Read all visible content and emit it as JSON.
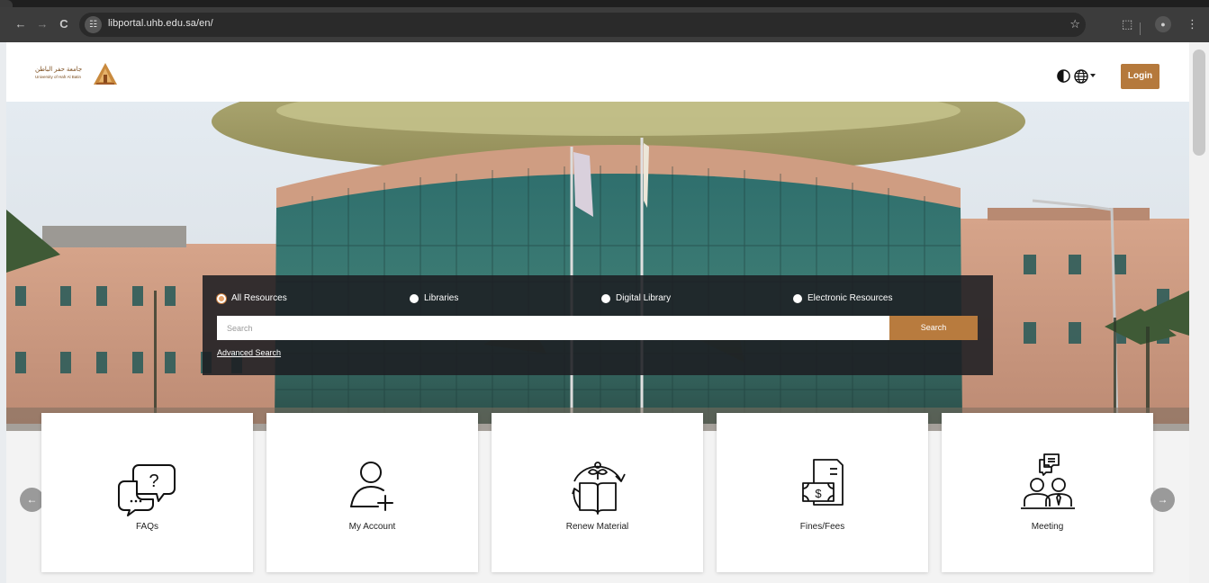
{
  "browser": {
    "url": "libportal.uhb.edu.sa/en/",
    "nav_back": "←",
    "nav_forward": "→",
    "nav_reload": "C",
    "site_info_glyph": "☷",
    "star_glyph": "☆",
    "extensions_glyph": "⬚",
    "profile_glyph": "●",
    "menu_glyph": "⋮"
  },
  "header": {
    "logo_ar": "جامعة حفر الباطن",
    "logo_en": "University of Hafr Al Batin",
    "login_label": "Login"
  },
  "search": {
    "radios": [
      {
        "label": "All Resources",
        "checked": true
      },
      {
        "label": "Libraries",
        "checked": false
      },
      {
        "label": "Digital Library",
        "checked": false
      },
      {
        "label": "Electronic Resources",
        "checked": false
      }
    ],
    "placeholder": "Search",
    "button_label": "Search",
    "advanced_label": "Advanced Search"
  },
  "cards": [
    {
      "label": "FAQs",
      "icon": "faq-chat-icon"
    },
    {
      "label": "My Account",
      "icon": "add-user-icon"
    },
    {
      "label": "Renew Material",
      "icon": "renew-book-icon"
    },
    {
      "label": "Fines/Fees",
      "icon": "fines-invoice-icon"
    },
    {
      "label": "Meeting",
      "icon": "meeting-icon"
    }
  ],
  "carousel": {
    "prev_glyph": "←",
    "next_glyph": "→"
  },
  "colors": {
    "accent": "#b5793c",
    "panel": "#1c1e22",
    "radio_checked": "#e6a066"
  }
}
